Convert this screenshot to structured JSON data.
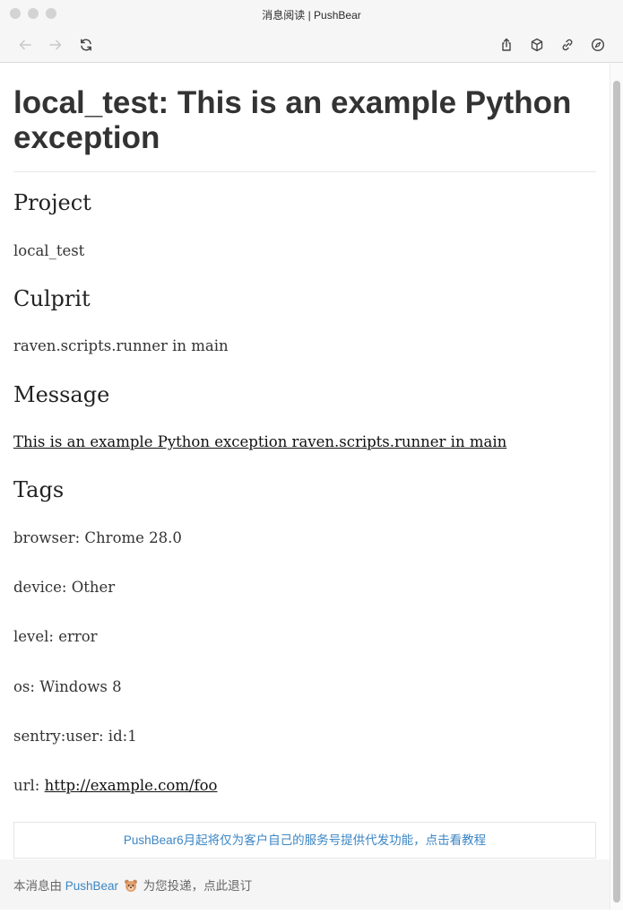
{
  "window": {
    "title": "消息阅读 | PushBear"
  },
  "toolbar": {
    "back_icon": "arrow-left-icon",
    "forward_icon": "arrow-right-icon",
    "reload_icon": "reload-icon",
    "share_icon": "share-icon",
    "package_icon": "box-icon",
    "link_icon": "link-icon",
    "compass_icon": "compass-icon"
  },
  "article": {
    "title": "local_test: This is an example Python exception",
    "sections": {
      "project": {
        "heading": "Project",
        "value": "local_test"
      },
      "culprit": {
        "heading": "Culprit",
        "value": "raven.scripts.runner in main"
      },
      "message": {
        "heading": "Message",
        "value": "This is an example Python exception raven.scripts.runner in main"
      },
      "tags": {
        "heading": "Tags",
        "items": [
          "browser: Chrome 28.0",
          "device: Other",
          "level: error",
          "os: Windows 8",
          "sentry:user: id:1"
        ],
        "url_label": "url: ",
        "url_value": "http://example.com/foo"
      }
    }
  },
  "notice": {
    "text": "PushBear6月起将仅为客户自己的服务号提供代发功能，点击看教程"
  },
  "footer": {
    "prefix": "本消息由",
    "brand": "PushBear",
    "suffix": "为您投递，点此退订",
    "brand_color": "#3b86c4"
  }
}
